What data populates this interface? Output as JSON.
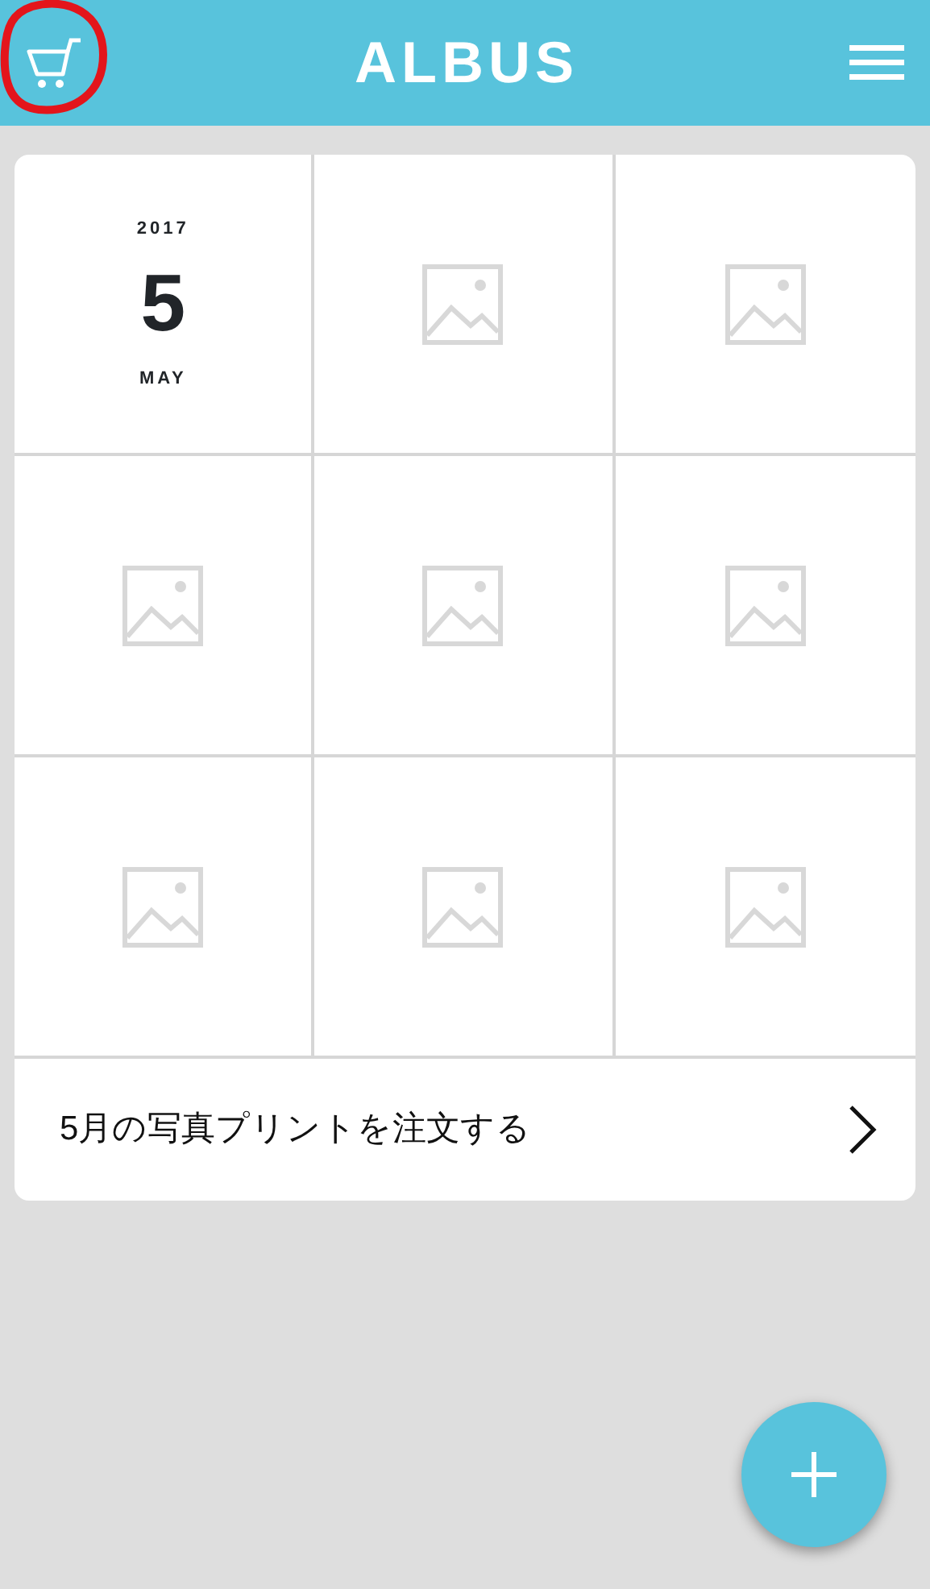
{
  "header": {
    "title": "ALBUS",
    "cart_circled": true
  },
  "grid": [
    {
      "kind": "date",
      "year": "2017",
      "day": "5",
      "month": "MAY"
    },
    {
      "kind": "placeholder"
    },
    {
      "kind": "placeholder"
    },
    {
      "kind": "placeholder"
    },
    {
      "kind": "placeholder"
    },
    {
      "kind": "placeholder"
    },
    {
      "kind": "placeholder"
    },
    {
      "kind": "placeholder"
    },
    {
      "kind": "placeholder"
    }
  ],
  "order_link": {
    "label": "5月の写真プリントを注文する"
  }
}
